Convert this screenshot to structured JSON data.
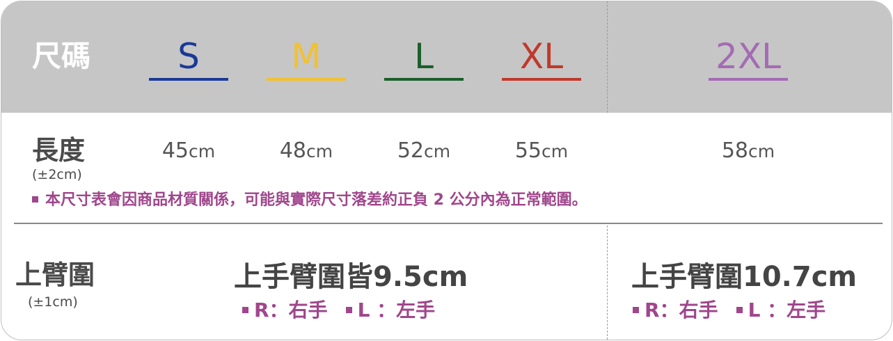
{
  "header": {
    "label": "尺碼"
  },
  "sizes": [
    {
      "name": "S",
      "color": "#1a3a96"
    },
    {
      "name": "M",
      "color": "#f2c12e"
    },
    {
      "name": "L",
      "color": "#1b5e2a"
    },
    {
      "name": "XL",
      "color": "#c0392b"
    },
    {
      "name": "2XL",
      "color": "#a46bb4"
    }
  ],
  "length": {
    "label": "長度",
    "tolerance": "(±2cm)",
    "values": [
      {
        "num": "45",
        "unit": "cm"
      },
      {
        "num": "48",
        "unit": "cm"
      },
      {
        "num": "52",
        "unit": "cm"
      },
      {
        "num": "55",
        "unit": "cm"
      },
      {
        "num": "58",
        "unit": "cm"
      }
    ],
    "note": "本尺寸表會因商品材質關係，可能與實際尺寸落差約正負 2 公分內為正常範圍。"
  },
  "arm": {
    "label": "上臂圍",
    "tolerance": "(±1cm)",
    "standard": "上手臂圍皆9.5cm",
    "large": "上手臂圍10.7cm",
    "right_hand": "R：右手",
    "left_hand": "L ：左手"
  }
}
